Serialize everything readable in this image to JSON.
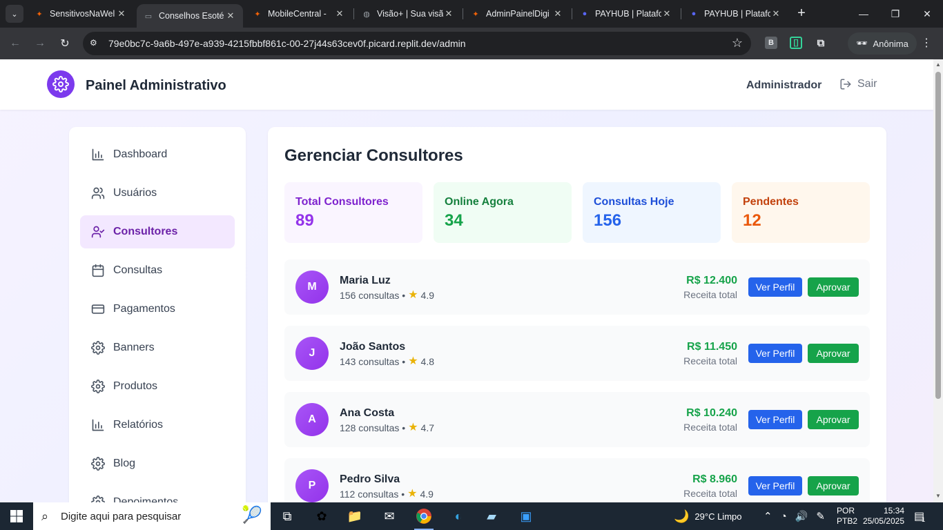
{
  "browser": {
    "tabs": [
      {
        "title": "SensitivosNaWel",
        "favicon": "replit-icon",
        "color": "#f26207"
      },
      {
        "title": "Conselhos Esoté",
        "favicon": "page-icon",
        "color": "#9aa0a6",
        "active": true
      },
      {
        "title": "MobileCentral -",
        "favicon": "replit-icon",
        "color": "#f26207"
      },
      {
        "title": "Visão+ | Sua visã",
        "favicon": "globe-icon",
        "color": "#9aa0a6"
      },
      {
        "title": "AdminPainelDigi",
        "favicon": "replit-icon",
        "color": "#f26207"
      },
      {
        "title": "PAYHUB | Platafo",
        "favicon": "discord-icon",
        "color": "#5865f2"
      },
      {
        "title": "PAYHUB | Platafo",
        "favicon": "discord-icon",
        "color": "#5865f2"
      }
    ],
    "url": "79e0bc7c-9a6b-497e-a939-4215fbbf861c-00-27j44s63cev0f.picard.replit.dev/admin",
    "profile_label": "Anônima"
  },
  "header": {
    "title": "Painel Administrativo",
    "user": "Administrador",
    "logout": "Sair"
  },
  "sidebar": {
    "items": [
      {
        "label": "Dashboard",
        "icon": "bar-chart-icon"
      },
      {
        "label": "Usuários",
        "icon": "users-icon"
      },
      {
        "label": "Consultores",
        "icon": "user-check-icon",
        "active": true
      },
      {
        "label": "Consultas",
        "icon": "calendar-icon"
      },
      {
        "label": "Pagamentos",
        "icon": "credit-card-icon"
      },
      {
        "label": "Banners",
        "icon": "gear-icon"
      },
      {
        "label": "Produtos",
        "icon": "gear-icon"
      },
      {
        "label": "Relatórios",
        "icon": "bar-chart-icon"
      },
      {
        "label": "Blog",
        "icon": "gear-icon"
      },
      {
        "label": "Depoimentos",
        "icon": "gear-icon"
      }
    ]
  },
  "main": {
    "title": "Gerenciar Consultores",
    "stats": [
      {
        "label": "Total Consultores",
        "value": "89",
        "bg": "#faf5ff",
        "color": "#7e22ce",
        "val_color": "#9333ea"
      },
      {
        "label": "Online Agora",
        "value": "34",
        "bg": "#f0fdf4",
        "color": "#15803d",
        "val_color": "#16a34a"
      },
      {
        "label": "Consultas Hoje",
        "value": "156",
        "bg": "#eff6ff",
        "color": "#1d4ed8",
        "val_color": "#2563eb"
      },
      {
        "label": "Pendentes",
        "value": "12",
        "bg": "#fff7ed",
        "color": "#c2410c",
        "val_color": "#ea580c"
      }
    ],
    "revenue_label": "Receita total",
    "view_label": "Ver Perfil",
    "approve_label": "Aprovar",
    "consultants": [
      {
        "initial": "M",
        "name": "Maria Luz",
        "consultas": "156 consultas •",
        "rating": "4.9",
        "revenue": "R$ 12.400"
      },
      {
        "initial": "J",
        "name": "João Santos",
        "consultas": "143 consultas •",
        "rating": "4.8",
        "revenue": "R$ 11.450"
      },
      {
        "initial": "A",
        "name": "Ana Costa",
        "consultas": "128 consultas •",
        "rating": "4.7",
        "revenue": "R$ 10.240"
      },
      {
        "initial": "P",
        "name": "Pedro Silva",
        "consultas": "112 consultas •",
        "rating": "4.9",
        "revenue": "R$ 8.960"
      }
    ]
  },
  "taskbar": {
    "search_placeholder": "Digite aqui para pesquisar",
    "weather": "29°C  Limpo",
    "lang_1": "POR",
    "lang_2": "PTB2",
    "time": "15:34",
    "date": "25/05/2025",
    "notifications": "1"
  }
}
